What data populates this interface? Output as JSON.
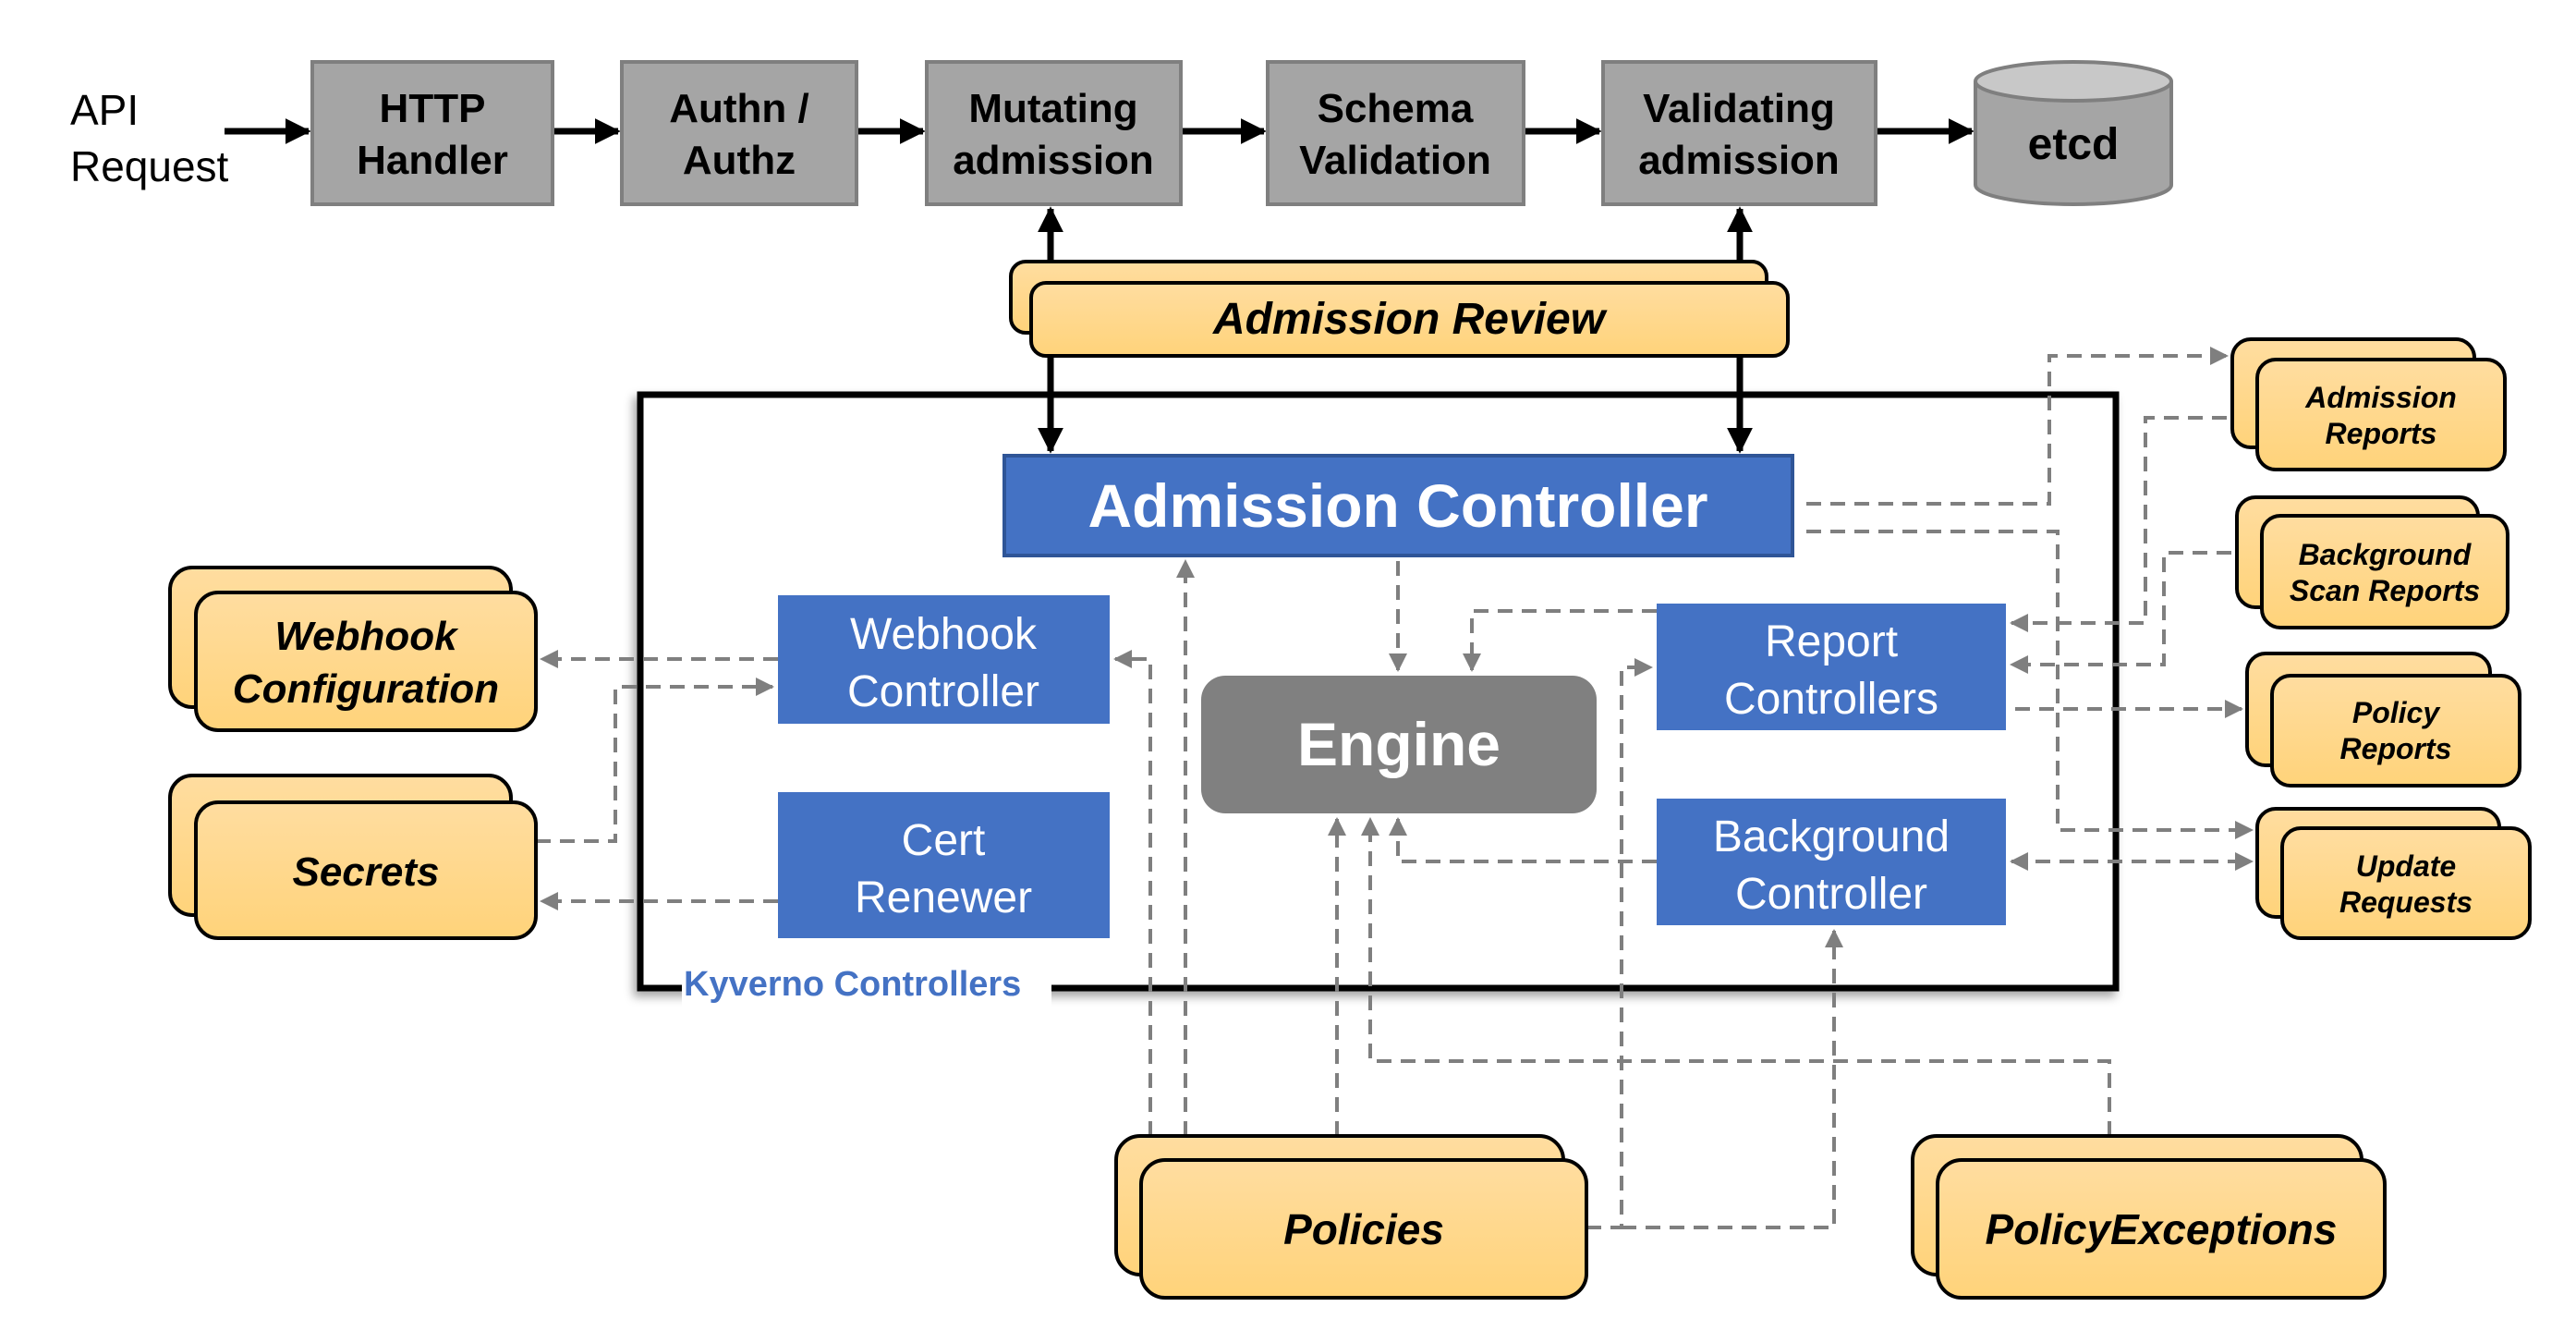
{
  "pipeline": {
    "source_label_line1": "API",
    "source_label_line2": "Request",
    "stages": [
      {
        "line1": "HTTP",
        "line2": "Handler"
      },
      {
        "line1": "Authn /",
        "line2": "Authz"
      },
      {
        "line1": "Mutating",
        "line2": "admission"
      },
      {
        "line1": "Schema",
        "line2": "Validation"
      },
      {
        "line1": "Validating",
        "line2": "admission"
      }
    ],
    "storage": "etcd"
  },
  "admission_review": "Admission Review",
  "kyverno": {
    "group_label": "Kyverno Controllers",
    "admission_controller": "Admission Controller",
    "webhook_controller": {
      "line1": "Webhook",
      "line2": "Controller"
    },
    "cert_renewer": {
      "line1": "Cert",
      "line2": "Renewer"
    },
    "engine": "Engine",
    "report_controllers": {
      "line1": "Report",
      "line2": "Controllers"
    },
    "background_controller": {
      "line1": "Background",
      "line2": "Controller"
    }
  },
  "resources_left": {
    "webhook_configuration": {
      "line1": "Webhook",
      "line2": "Configuration"
    },
    "secrets": "Secrets"
  },
  "resources_right": {
    "admission_reports": {
      "line1": "Admission",
      "line2": "Reports"
    },
    "background_scan_reports": {
      "line1": "Background",
      "line2": "Scan Reports"
    },
    "policy_reports": {
      "line1": "Policy",
      "line2": "Reports"
    },
    "update_requests": {
      "line1": "Update",
      "line2": "Requests"
    }
  },
  "resources_bottom": {
    "policies": "Policies",
    "policy_exceptions": "PolicyExceptions"
  },
  "colors": {
    "pipeline_fill": "#A5A5A5",
    "controller_blue": "#4472C4",
    "engine_gray": "#808080",
    "resource_yellow_top": "#FFDDA0",
    "resource_yellow_bottom": "#FFD37A",
    "dashed_line": "#7F7F7F"
  }
}
